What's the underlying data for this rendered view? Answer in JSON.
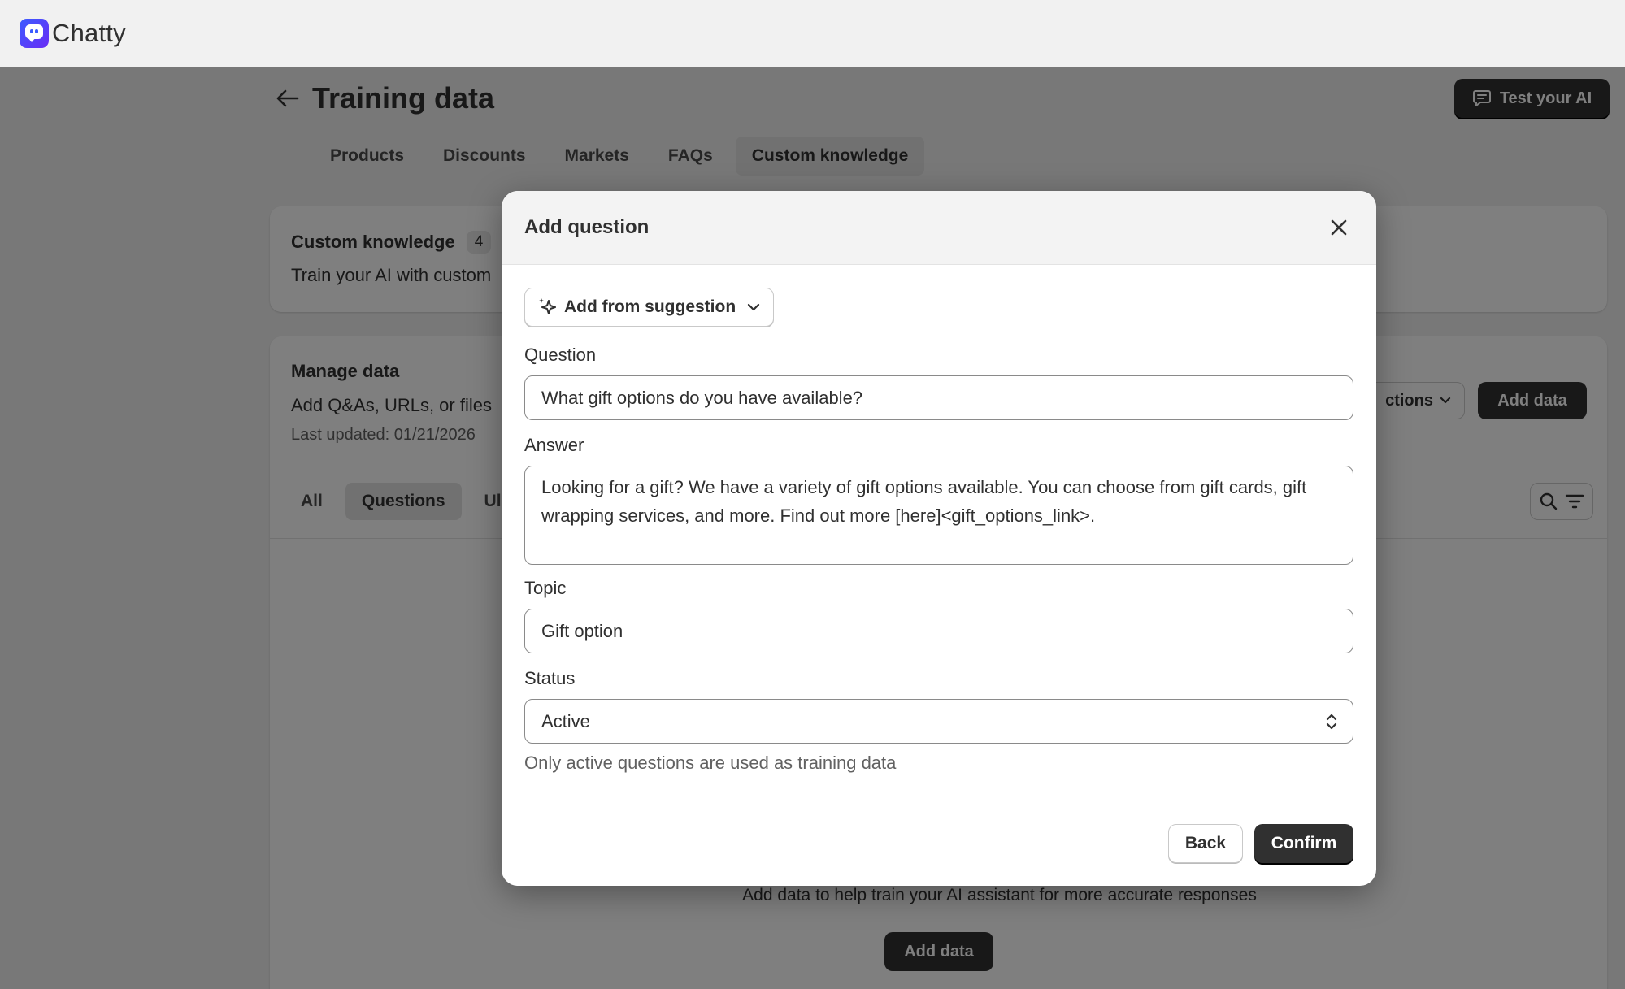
{
  "app": {
    "name": "Chatty"
  },
  "page": {
    "title": "Training data",
    "test_ai_label": "Test your AI",
    "tabs": [
      {
        "label": "Products"
      },
      {
        "label": "Discounts"
      },
      {
        "label": "Markets"
      },
      {
        "label": "FAQs"
      },
      {
        "label": "Custom knowledge",
        "active": true
      }
    ]
  },
  "custom_knowledge": {
    "title": "Custom knowledge",
    "count": "4",
    "description": "Train your AI with custom"
  },
  "manage": {
    "title": "Manage data",
    "description": "Add Q&As, URLs, or files",
    "last_updated": "Last updated: 01/21/2026",
    "actions_label": "ctions",
    "add_data_label": "Add data",
    "filter_tabs": [
      {
        "label": "All"
      },
      {
        "label": "Questions",
        "active": true
      },
      {
        "label": "Ul"
      }
    ],
    "empty_text": "Add data to help train your AI assistant for more accurate responses",
    "empty_add_label": "Add data"
  },
  "modal": {
    "title": "Add question",
    "suggestion_label": "Add from suggestion",
    "question_label": "Question",
    "question_value": "What gift options do you have available?",
    "answer_label": "Answer",
    "answer_value": "Looking for a gift? We have a variety of gift options available. You can choose from gift cards, gift wrapping services, and more. Find out more [here]<gift_options_link>.",
    "topic_label": "Topic",
    "topic_value": "Gift option",
    "status_label": "Status",
    "status_value": "Active",
    "status_help": "Only active questions are used as training data",
    "back_label": "Back",
    "confirm_label": "Confirm"
  }
}
